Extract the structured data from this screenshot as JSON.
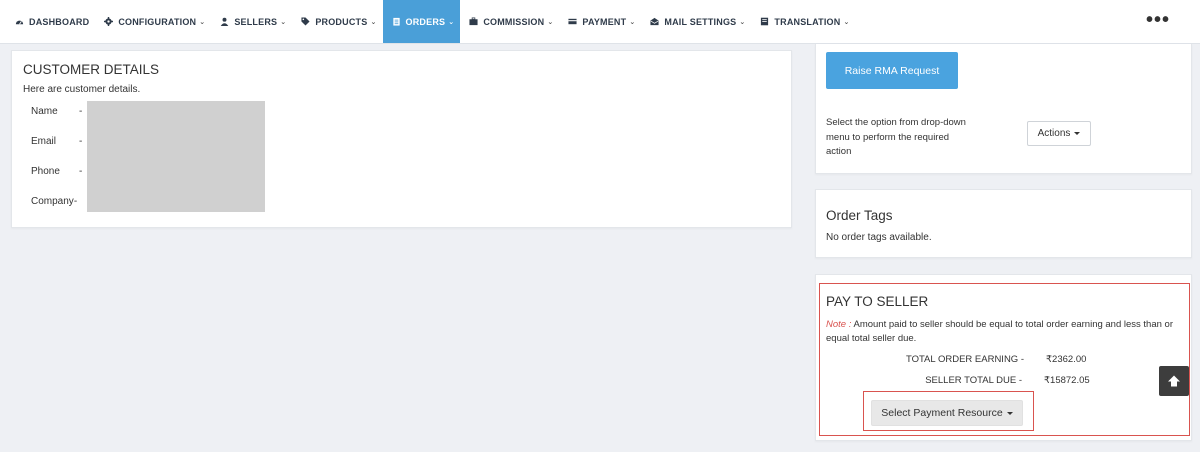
{
  "nav": {
    "items": [
      {
        "label": "DASHBOARD",
        "icon": "dashboard-icon",
        "dropdown": false
      },
      {
        "label": "CONFIGURATION",
        "icon": "gear-icon",
        "dropdown": true
      },
      {
        "label": "SELLERS",
        "icon": "user-icon",
        "dropdown": true
      },
      {
        "label": "PRODUCTS",
        "icon": "tag-icon",
        "dropdown": true
      },
      {
        "label": "ORDERS",
        "icon": "clipboard-icon",
        "dropdown": true,
        "active": true
      },
      {
        "label": "COMMISSION",
        "icon": "briefcase-icon",
        "dropdown": true
      },
      {
        "label": "PAYMENT",
        "icon": "credit-card-icon",
        "dropdown": true
      },
      {
        "label": "MAIL SETTINGS",
        "icon": "envelope-icon",
        "dropdown": true
      },
      {
        "label": "TRANSLATION",
        "icon": "book-icon",
        "dropdown": true
      }
    ],
    "more": "•••",
    "active_color": "#4a9fd8"
  },
  "customer": {
    "title": "CUSTOMER DETAILS",
    "subtitle": "Here are customer details.",
    "fields": [
      {
        "label": "Name",
        "sep": "-"
      },
      {
        "label": "Email",
        "sep": "-"
      },
      {
        "label": "Phone",
        "sep": "-"
      },
      {
        "label": "Company",
        "sep": "-"
      }
    ]
  },
  "rma": {
    "button": "Raise RMA Request",
    "instruction": "Select the option from drop-down menu to perform the required action",
    "actions": "Actions"
  },
  "tags": {
    "title": "Order Tags",
    "empty": "No order tags available."
  },
  "pay": {
    "title": "PAY TO SELLER",
    "note_label": "Note :",
    "note": "Amount paid to seller should be equal to total order earning and less than or equal total seller due.",
    "earning_label": "TOTAL ORDER EARNING -",
    "earning_value": "₹2362.00",
    "due_label": "SELLER TOTAL DUE -",
    "due_value": "₹15872.05",
    "select_button": "Select Payment Resource",
    "highlight_color": "#d9534f"
  },
  "colors": {
    "primary_button": "#4aa3df",
    "background": "#eef0f4"
  }
}
